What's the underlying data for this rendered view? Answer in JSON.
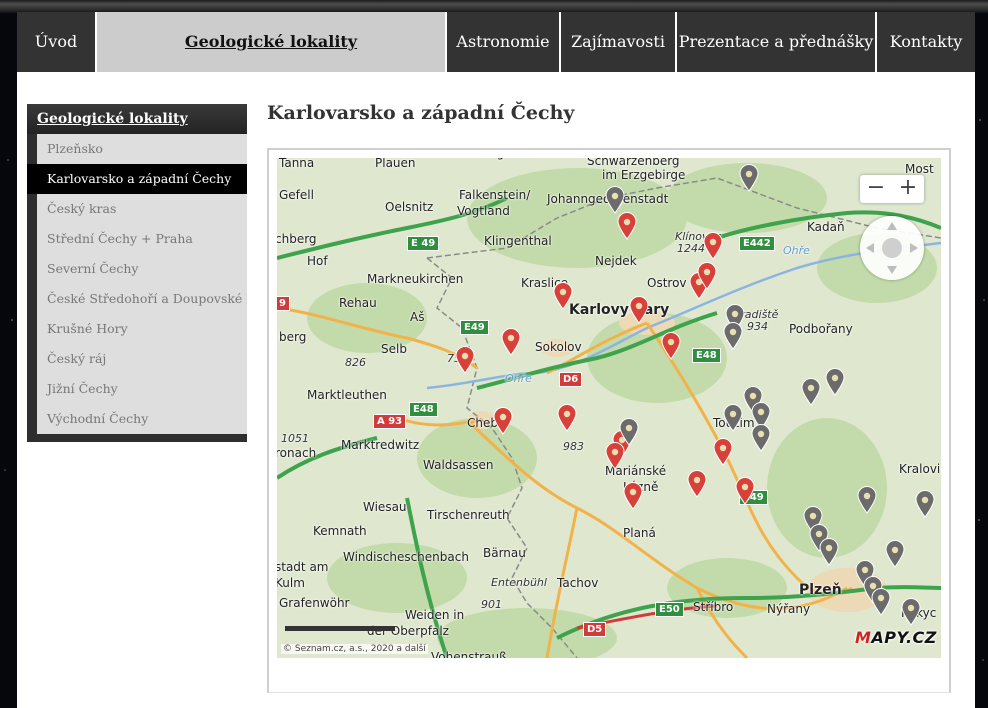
{
  "nav": {
    "items": [
      {
        "label": "Úvod"
      },
      {
        "label": "Geologické lokality",
        "active": true
      },
      {
        "label": "Astronomie"
      },
      {
        "label": "Zajímavosti"
      },
      {
        "label": "Prezentace a přednášky"
      },
      {
        "label": "Kontakty"
      }
    ]
  },
  "sidebar": {
    "heading": "Geologické lokality",
    "items": [
      {
        "label": "Plzeňsko"
      },
      {
        "label": "Karlovarsko a západní Čechy",
        "active": true
      },
      {
        "label": "Český kras"
      },
      {
        "label": "Střední Čechy + Praha"
      },
      {
        "label": "Severní Čechy"
      },
      {
        "label": "České Středohoří a Doupovské hory"
      },
      {
        "label": "Krušné Hory"
      },
      {
        "label": "Český ráj"
      },
      {
        "label": "Jižní Čechy"
      },
      {
        "label": "Východní Čechy"
      }
    ]
  },
  "main": {
    "title": "Karlovarsko a západní Čechy"
  },
  "map": {
    "places": [
      "Tanna",
      "Plauen",
      "Vogtland",
      "Schwarzenberg",
      "im Erzgebirge",
      "Most",
      "Gefell",
      "Oelsnitz",
      "Falkenstein/",
      "Vogtland",
      "Johanngeorgenstadt",
      "Kadaň",
      "chberg",
      "Klingenthal",
      "Klínovec",
      "1244",
      "Ohře",
      "Hof",
      "Markneukirchen",
      "Nejdek",
      "Ostrov",
      "Rehau",
      "Kraslice",
      "Karlovy Vary",
      "Hradiště",
      "934",
      "Podbořany",
      "berg",
      "Aš",
      "Sokolov",
      "Selb",
      "759",
      "826",
      "Ohře",
      "Marktleuthen",
      "Toužim",
      "Cheb",
      "1051",
      "Marktredwitz",
      "983",
      "ronach",
      "Waldsassen",
      "Mariánské",
      "Lázně",
      "Kralovi",
      "Wiesau",
      "Tirschenreuth",
      "Planá",
      "Kemnath",
      "Bärnau",
      "Windischeschenbach",
      "stadt am",
      "Kulm",
      "Tachov",
      "Entenbühl",
      "Plzeň",
      "Grafenwöhr",
      "901",
      "Stříbro",
      "Nýřany",
      "Rokyc",
      "Weiden in",
      "der Oberpfalz",
      "Vohenstrauß"
    ],
    "road_shields": [
      "E 49",
      "E442",
      "E49",
      "D6",
      "E48",
      "A 93",
      "E48",
      "E49",
      "E50",
      "D5",
      "9"
    ],
    "zoom_out_label": "−",
    "zoom_in_label": "+",
    "copyright": "© Seznam.cz, a.s., 2020 a další",
    "logo": "MAPY.CZ",
    "colors": {
      "active_pin": "#d9403a",
      "inactive_pin": "#6b6b6b",
      "motorway": "#3fa34d",
      "road": "#f2b24a"
    }
  }
}
